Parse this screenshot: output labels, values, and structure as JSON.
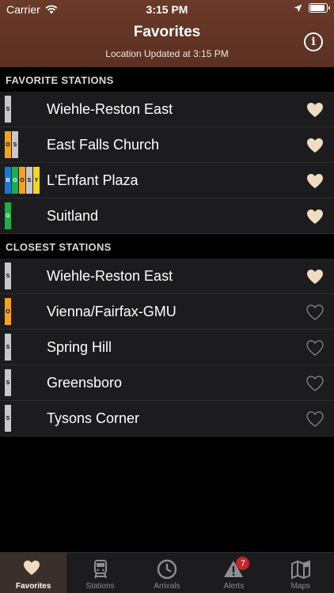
{
  "status_bar": {
    "carrier": "Carrier",
    "time": "3:15 PM"
  },
  "header": {
    "title": "Favorites",
    "subtitle": "Location Updated at 3:15 PM",
    "info_glyph": "i"
  },
  "colors": {
    "silver": "#c7c7cc",
    "orange": "#f7a21b",
    "blue": "#1578d3",
    "green": "#1cae4c",
    "yellow": "#f7d81a",
    "heart_on": "#efdcc1",
    "heart_off": "#8e8e93"
  },
  "favorite_section": {
    "title": "FAVORITE STATIONS",
    "rows": [
      {
        "name": "Wiehle-Reston East",
        "lines": [
          {
            "code": "S",
            "color": "#c7c7cc"
          }
        ],
        "favorite": true
      },
      {
        "name": "East Falls Church",
        "lines": [
          {
            "code": "O",
            "color": "#f7a21b"
          },
          {
            "code": "S",
            "color": "#c7c7cc"
          }
        ],
        "favorite": true
      },
      {
        "name": "L'Enfant Plaza",
        "lines": [
          {
            "code": "B",
            "color": "#1578d3"
          },
          {
            "code": "G",
            "color": "#1cae4c"
          },
          {
            "code": "O",
            "color": "#f7a21b"
          },
          {
            "code": "S",
            "color": "#c7c7cc"
          },
          {
            "code": "Y",
            "color": "#f7d81a"
          }
        ],
        "favorite": true
      },
      {
        "name": "Suitland",
        "lines": [
          {
            "code": "G",
            "color": "#1cae4c"
          }
        ],
        "favorite": true
      }
    ]
  },
  "closest_section": {
    "title": "CLOSEST STATIONS",
    "rows": [
      {
        "name": "Wiehle-Reston East",
        "lines": [
          {
            "code": "S",
            "color": "#c7c7cc"
          }
        ],
        "favorite": true
      },
      {
        "name": "Vienna/Fairfax-GMU",
        "lines": [
          {
            "code": "O",
            "color": "#f7a21b"
          }
        ],
        "favorite": false
      },
      {
        "name": "Spring Hill",
        "lines": [
          {
            "code": "S",
            "color": "#c7c7cc"
          }
        ],
        "favorite": false
      },
      {
        "name": "Greensboro",
        "lines": [
          {
            "code": "S",
            "color": "#c7c7cc"
          }
        ],
        "favorite": false
      },
      {
        "name": "Tysons Corner",
        "lines": [
          {
            "code": "S",
            "color": "#c7c7cc"
          }
        ],
        "favorite": false
      }
    ]
  },
  "tabs": [
    {
      "label": "Favorites",
      "icon": "heart-icon",
      "active": true
    },
    {
      "label": "Stations",
      "icon": "train-icon",
      "active": false
    },
    {
      "label": "Arrivals",
      "icon": "clock-icon",
      "active": false
    },
    {
      "label": "Alerts",
      "icon": "alert-icon",
      "active": false,
      "badge": "7"
    },
    {
      "label": "Maps",
      "icon": "map-icon",
      "active": false
    }
  ]
}
